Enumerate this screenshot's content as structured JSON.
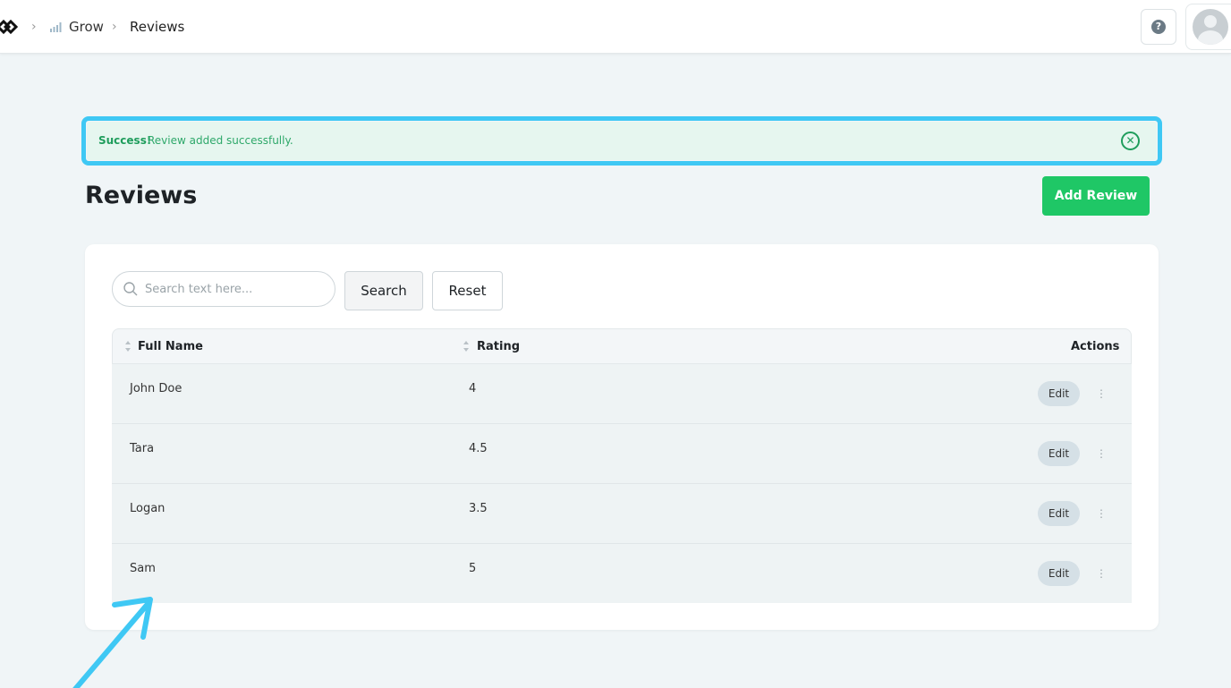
{
  "breadcrumb": {
    "separator": "›",
    "items": [
      "Grow",
      "Reviews"
    ]
  },
  "header": {
    "help_icon": "question-circle-icon",
    "help_glyph": "?",
    "avatar_icon": "user-avatar-icon"
  },
  "alert": {
    "strong": "Success!",
    "message": "Review added successfully.",
    "close_glyph": "✕",
    "outline_color": "#3fc8f4"
  },
  "page": {
    "title": "Reviews",
    "add_button": "Add Review"
  },
  "search": {
    "placeholder": "Search text here...",
    "search_button": "Search",
    "reset_button": "Reset"
  },
  "table": {
    "columns": [
      "Full Name",
      "Rating",
      "Actions"
    ],
    "rows": [
      {
        "name": "John Doe",
        "rating": "4",
        "edit": "Edit",
        "more": "⋮"
      },
      {
        "name": "Tara",
        "rating": "4.5",
        "edit": "Edit",
        "more": "⋮"
      },
      {
        "name": "Logan",
        "rating": "3.5",
        "edit": "Edit",
        "more": "⋮"
      },
      {
        "name": "Sam",
        "rating": "5",
        "edit": "Edit",
        "more": "⋮"
      }
    ]
  },
  "colors": {
    "accent_green": "#1fc766",
    "alert_bg": "#e6f6ef",
    "annotation": "#3fc8f4"
  }
}
